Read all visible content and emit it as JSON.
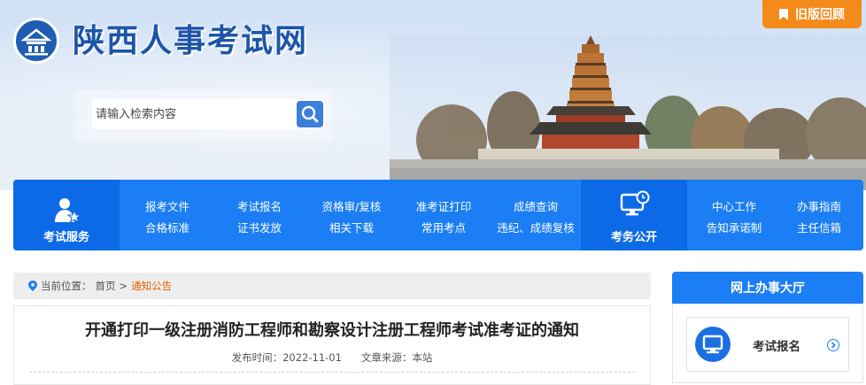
{
  "site": {
    "title": "陕西人事考试网",
    "old_version_label": "旧版回顾"
  },
  "search": {
    "placeholder": "请输入检索内容"
  },
  "nav": {
    "exam_service": "考试服务",
    "exam_public": "考务公开",
    "columns": [
      {
        "top": "报考文件",
        "bottom": "合格标准"
      },
      {
        "top": "考试报名",
        "bottom": "证书发放"
      },
      {
        "top": "资格审/复核",
        "bottom": "相关下载"
      },
      {
        "top": "准考证打印",
        "bottom": "常用考点"
      },
      {
        "top": "成绩查询",
        "bottom": "违纪、成绩复核"
      }
    ],
    "right_columns": [
      {
        "top": "中心工作",
        "bottom": "告知承诺制"
      },
      {
        "top": "办事指南",
        "bottom": "主任信箱"
      }
    ]
  },
  "breadcrumb": {
    "prefix": "当前位置：",
    "home": "首页",
    "sep": ">",
    "current": "通知公告"
  },
  "article": {
    "title": "开通打印一级注册消防工程师和勘察设计注册工程师考试准考证的通知",
    "date_label": "发布时间：",
    "date": "2022-11-01",
    "source_label": "文章来源：",
    "source": "本站"
  },
  "sidebar": {
    "header": "网上办事大厅",
    "card_label": "考试报名"
  },
  "colors": {
    "primary_blue": "#1b7ef4",
    "orange": "#f38a1a",
    "title_blue": "#1c55a8"
  }
}
